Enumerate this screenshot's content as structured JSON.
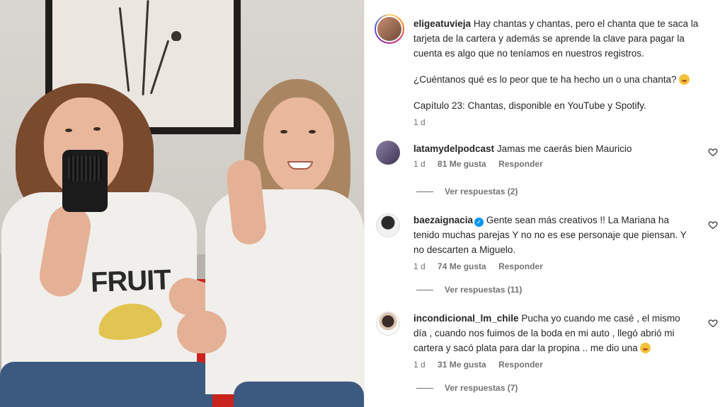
{
  "post": {
    "username": "eligeatuvieja",
    "caption_line1": "Hay chantas y chantas, pero el chanta que te saca la",
    "caption_line2": "tarjeta de la cartera y además se aprende la clave para pagar la",
    "caption_line3": "cuenta es algo que no teníamos en nuestros registros.",
    "question": "¿Cuéntanos qué es lo peor que te ha hecho un o una chanta?",
    "episode": "Capítulo 23: Chantas, disponible en YouTube y Spotify.",
    "time": "1 d"
  },
  "comments": [
    {
      "username": "latamydelpodcast",
      "lines": [
        "Jamas me caerás bien Mauricio"
      ],
      "time": "1 d",
      "likes": "81 Me gusta",
      "reply": "Responder",
      "view_replies": "Ver respuestas (2)"
    },
    {
      "username": "baezaignacia",
      "verified": true,
      "lines": [
        "Gente sean más creativos !! La Mariana ha",
        "tenido muchas parejas Y no no es ese personaje que piensan. Y",
        "no descarten a Miguelo."
      ],
      "time": "1 d",
      "likes": "74 Me gusta",
      "reply": "Responder",
      "view_replies": "Ver respuestas (11)"
    },
    {
      "username": "incondicional_lm_chile",
      "lines": [
        "Pucha yo cuando me casé , el mismo",
        "día , cuando nos fuimos de la boda en mi auto , llegó abrió mi",
        "cartera y sacó plata para dar la propina .. me dio una"
      ],
      "time": "1 d",
      "likes": "31 Me gusta",
      "reply": "Responder",
      "view_replies": "Ver respuestas (7)"
    }
  ],
  "photo": {
    "shirt_print": "FRUIT"
  },
  "icons": {
    "like": "heart-outline-icon",
    "verified": "verified-badge-icon",
    "emoji": "smiling-emoji-icon"
  },
  "colors": {
    "text": "#262626",
    "secondary": "#737373",
    "verified": "#0095f6"
  }
}
